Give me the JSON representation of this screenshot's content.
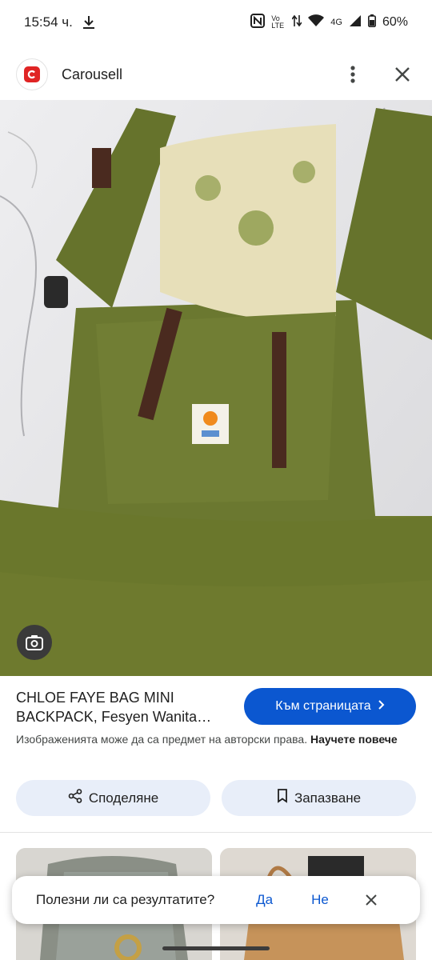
{
  "status_bar": {
    "time": "15:54 ч.",
    "volte_top": "Vo",
    "volte_bottom": "LTE",
    "network": "4G",
    "battery": "60%"
  },
  "header": {
    "site_name": "Carousell",
    "menu_icon": "more-vert-icon",
    "close_icon": "close-icon"
  },
  "result": {
    "title": "CHLOE FAYE BAG MINI BACKPACK, Fesyen Wanita…",
    "visit_button": "Към страницата",
    "copyright_text": "Изображенията може да са предмет на авторски права.",
    "copyright_link": "Научете повече",
    "share_label": "Споделяне",
    "save_label": "Запазване"
  },
  "feedback": {
    "question": "Полезни ли са резултатите?",
    "yes": "Да",
    "no": "Не"
  },
  "colors": {
    "accent": "#0b57d0",
    "pill_bg": "#e8eef9",
    "brand_red": "#e02424"
  }
}
